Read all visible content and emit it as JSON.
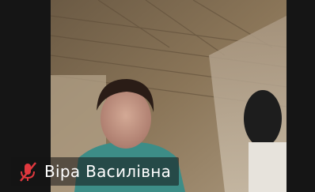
{
  "participant": {
    "name": "Віра Василівна",
    "mic_status_icon": "mic-muted-icon",
    "mic_icon_color": "#e0383e"
  }
}
